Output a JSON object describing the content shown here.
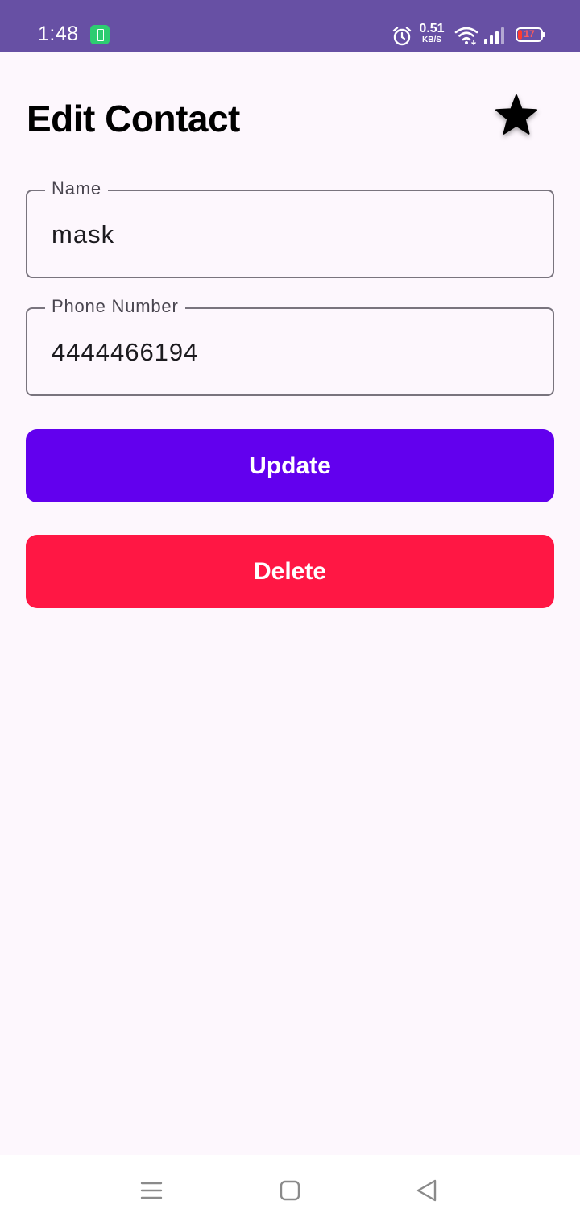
{
  "status_bar": {
    "time": "1:48",
    "net_speed_value": "0.51",
    "net_speed_unit": "KB/S",
    "battery_level": "17",
    "background_color": "#6750a4"
  },
  "header": {
    "title": "Edit Contact",
    "favorite_icon": "star-icon"
  },
  "form": {
    "name_label": "Name",
    "name_value": "mask",
    "phone_label": "Phone Number",
    "phone_value": "4444466194"
  },
  "actions": {
    "update_label": "Update",
    "update_color": "#6200ee",
    "delete_label": "Delete",
    "delete_color": "#ff1744"
  },
  "nav_bar": {
    "recents_icon": "menu-icon",
    "home_icon": "home-square-icon",
    "back_icon": "back-triangle-icon"
  }
}
